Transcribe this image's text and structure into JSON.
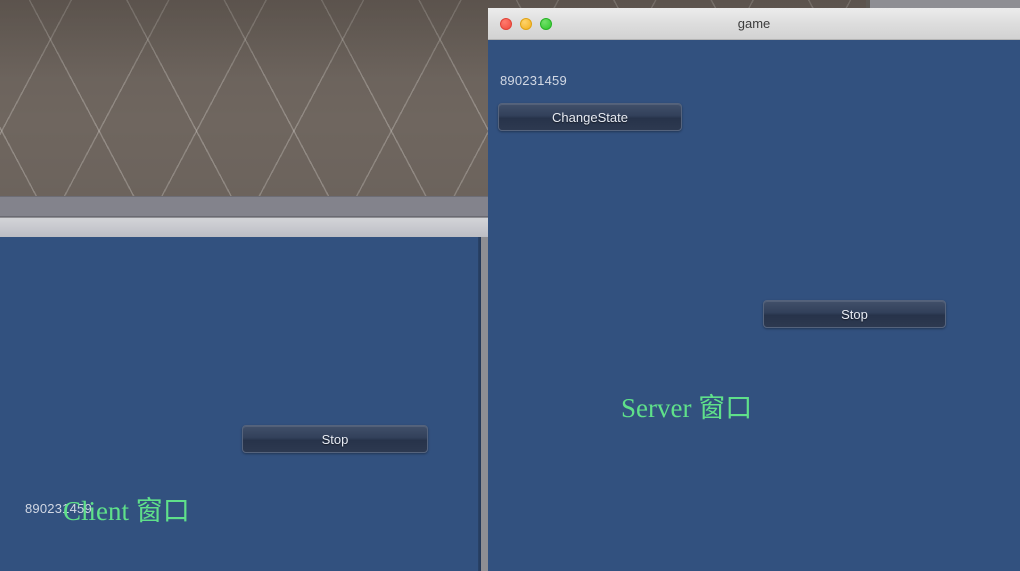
{
  "desktop": {
    "background_color": "#8e8e93",
    "scene_color": "#6f665f"
  },
  "client_window": {
    "name": "Client game window",
    "canvas_color": "#32517f",
    "id_label": "890231459",
    "buttons": [
      {
        "name": "stop",
        "label": "Stop"
      }
    ],
    "overlay_label": "Client 窗口",
    "overlay_color": "#5fe08a"
  },
  "server_window": {
    "name": "Server game window",
    "title": "game",
    "canvas_color": "#32517f",
    "traffic_lights": {
      "close": {
        "icon": "close-window-icon",
        "color": "#f04a3e"
      },
      "minimize": {
        "icon": "minimize-window-icon",
        "color": "#f2b01e"
      },
      "zoom": {
        "icon": "zoom-window-icon",
        "color": "#2ec72a"
      }
    },
    "id_label": "890231459",
    "buttons": [
      {
        "name": "change-state",
        "label": "ChangeState"
      },
      {
        "name": "stop",
        "label": "Stop"
      }
    ],
    "overlay_label": "Server 窗口",
    "overlay_color": "#5fe08a"
  }
}
